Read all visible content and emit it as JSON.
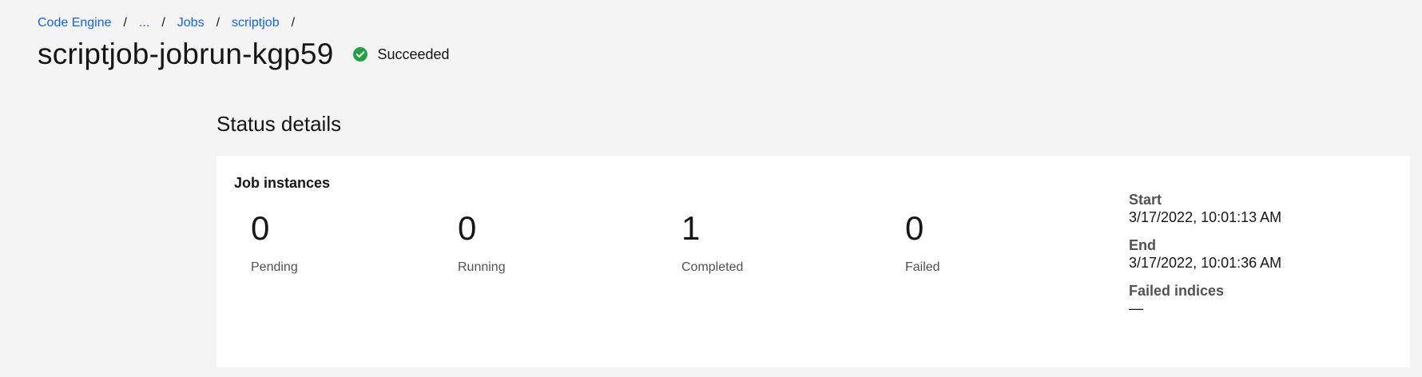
{
  "breadcrumb": {
    "items": [
      {
        "label": "Code Engine"
      },
      {
        "label": "..."
      },
      {
        "label": "Jobs"
      },
      {
        "label": "scriptjob"
      }
    ],
    "separator": "/"
  },
  "page": {
    "title": "scriptjob-jobrun-kgp59",
    "status": {
      "label": "Succeeded",
      "icon": "checkmark-filled-icon",
      "color": "#24a148"
    }
  },
  "status_details": {
    "title": "Status details",
    "card": {
      "title": "Job instances",
      "metrics": [
        {
          "value": "0",
          "label": "Pending"
        },
        {
          "value": "0",
          "label": "Running"
        },
        {
          "value": "1",
          "label": "Completed"
        },
        {
          "value": "0",
          "label": "Failed"
        }
      ],
      "details": [
        {
          "label": "Start",
          "value": "3/17/2022, 10:01:13 AM"
        },
        {
          "label": "End",
          "value": "3/17/2022, 10:01:36 AM"
        },
        {
          "label": "Failed indices",
          "value": "—"
        }
      ]
    }
  },
  "colors": {
    "link": "#0f62fe",
    "background": "#f4f4f4",
    "card": "#ffffff",
    "text": "#161616",
    "secondary_text": "#525252",
    "success": "#24a148"
  }
}
